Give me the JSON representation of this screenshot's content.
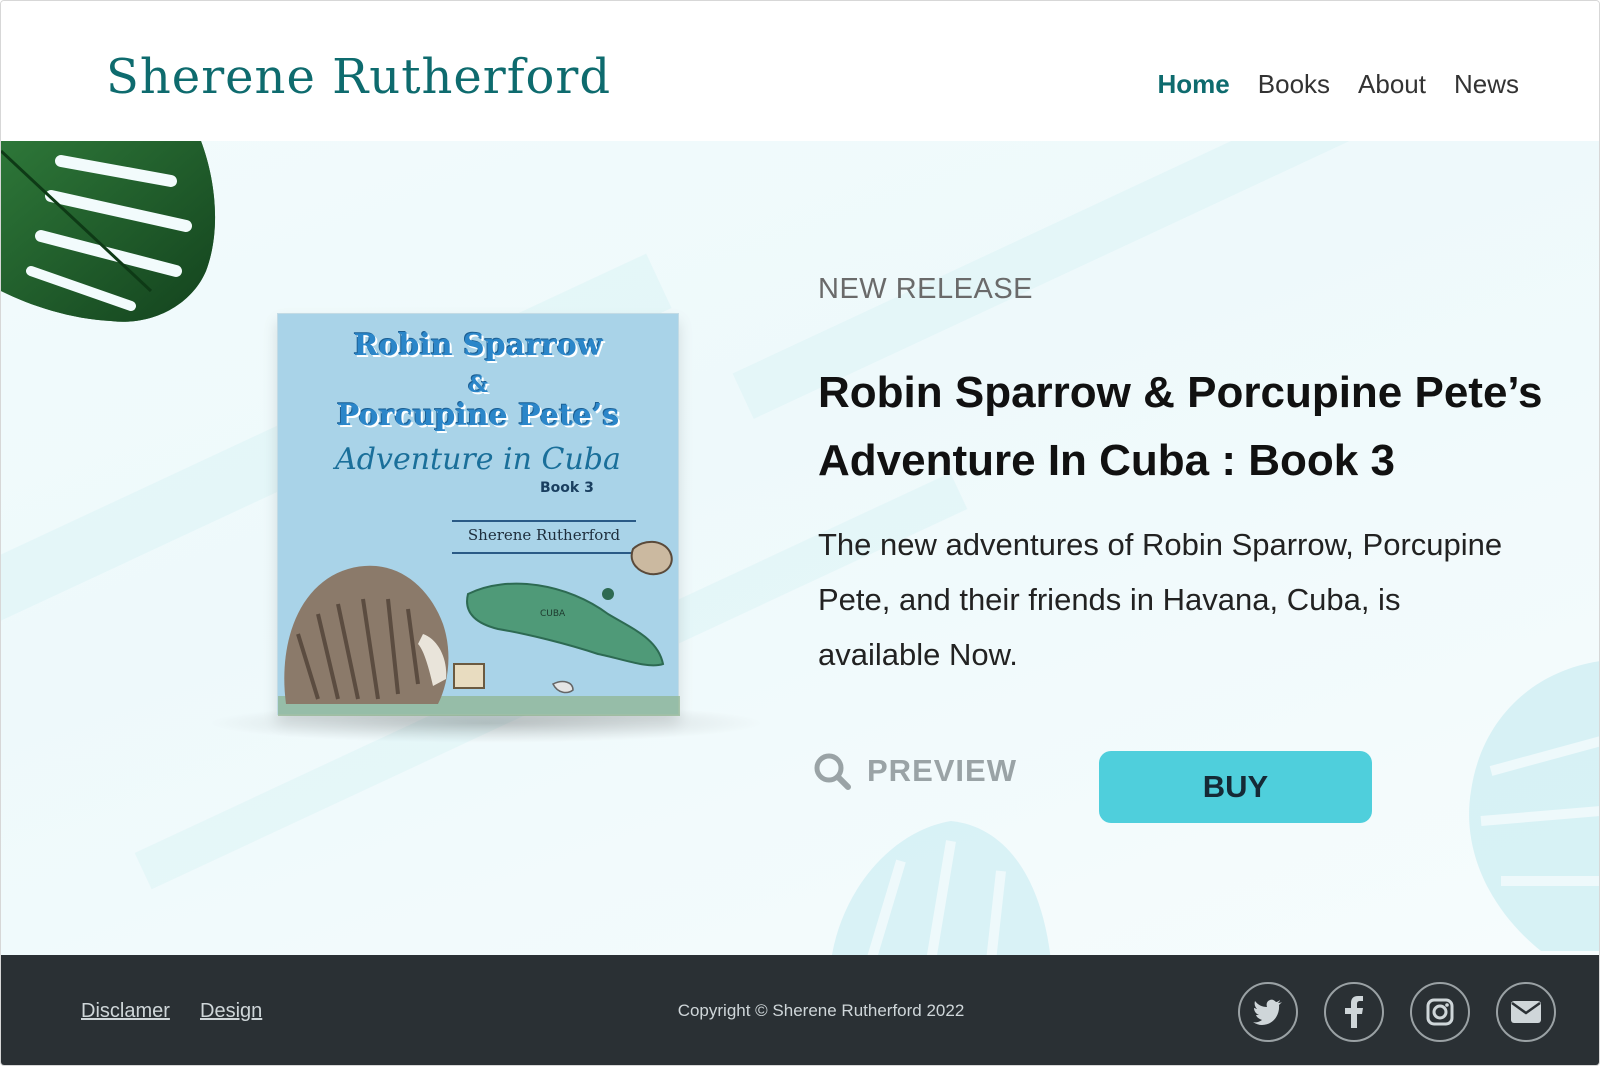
{
  "header": {
    "site_title": "Sherene Rutherford",
    "nav": [
      {
        "label": "Home",
        "active": true
      },
      {
        "label": "Books",
        "active": false
      },
      {
        "label": "About",
        "active": false
      },
      {
        "label": "News",
        "active": false
      }
    ]
  },
  "hero": {
    "kicker": "NEW RELEASE",
    "title": "Robin Sparrow & Porcupine Pete’s Adventure In Cuba : Book 3",
    "description": "The new adventures of Robin Sparrow, Porcupine Pete, and their friends in Havana, Cuba, is available Now.",
    "preview_label": "PREVIEW",
    "buy_label": "BUY",
    "cover": {
      "line1": "Robin Sparrow",
      "amp": "&",
      "line2": "Porcupine Pete’s",
      "subtitle": "Adventure in Cuba",
      "book": "Book 3",
      "author": "Sherene Rutherford",
      "map_label": "CUBA"
    }
  },
  "footer": {
    "links": [
      "Disclamer",
      "Design"
    ],
    "copyright": "Copyright © Sherene Rutherford 2022",
    "social": [
      "twitter-icon",
      "facebook-icon",
      "instagram-icon",
      "email-icon"
    ]
  },
  "colors": {
    "brand_teal": "#0e6b6e",
    "nav_active_bg": "#c9eff1",
    "buy_button": "#4fcfdc",
    "footer_bg": "#2a3034"
  }
}
